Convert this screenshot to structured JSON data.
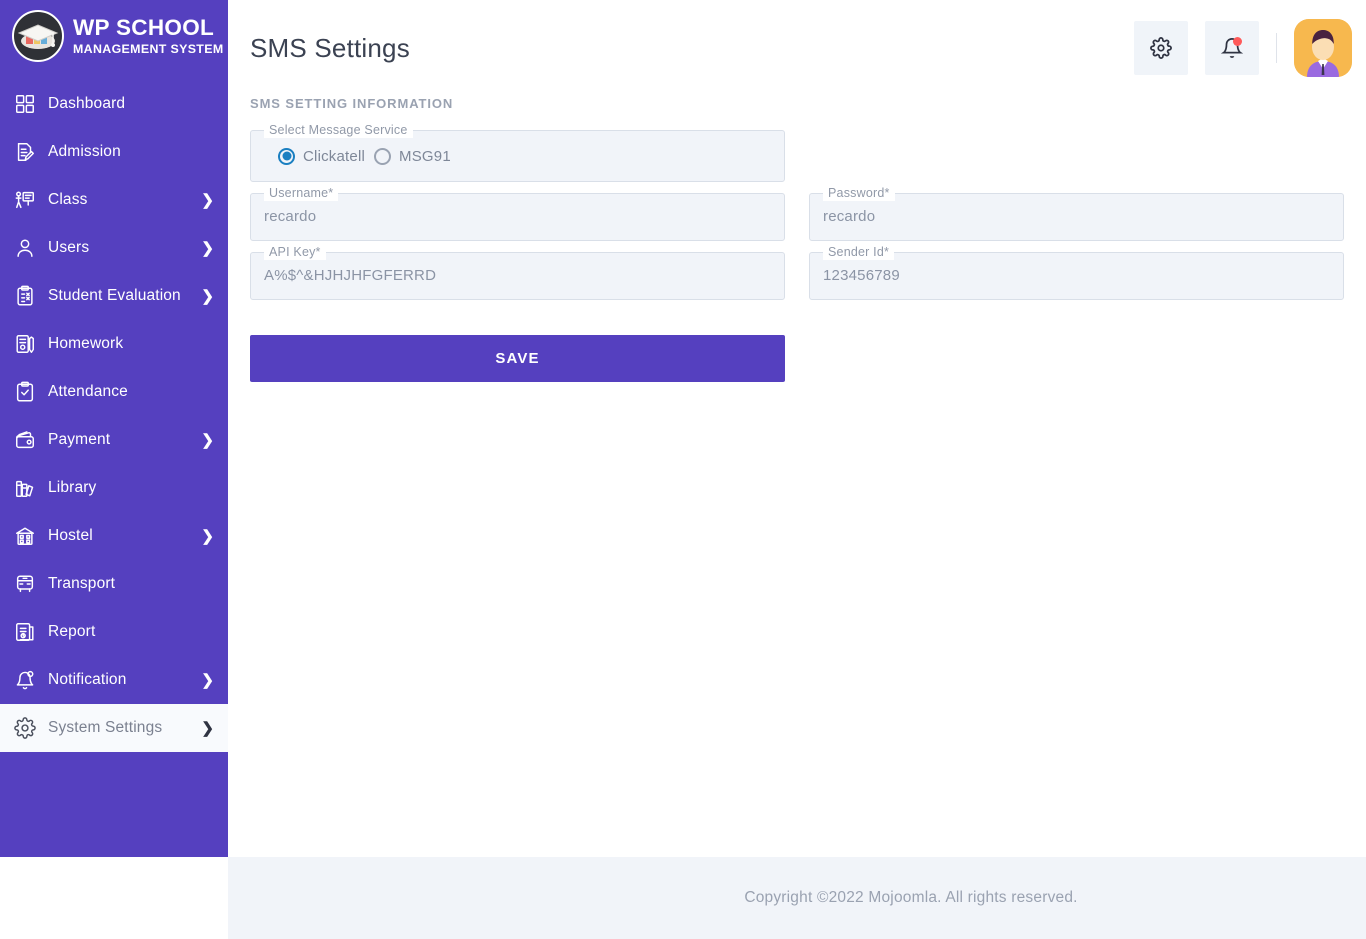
{
  "brand": {
    "logo_icon": "graduation-cap-icon",
    "name": "WP SCHOOL",
    "tagline": "MANAGEMENT SYSTEM"
  },
  "colors": {
    "sidebar_purple": "#5540bf",
    "accent_purple": "#5540bf",
    "field_bg": "#f1f4f9",
    "field_border": "#d9dfe8",
    "radio_blue": "#1a7fc1",
    "badge_red": "#ff5a5a",
    "avatar_bg": "#f7b84e",
    "footer_bg": "#f1f4f9",
    "muted_text": "#9aa2b1"
  },
  "sidebar": {
    "items": [
      {
        "label": "Dashboard",
        "icon": "grid-dashboard-icon",
        "has_arrow": false,
        "active": false
      },
      {
        "label": "Admission",
        "icon": "document-pencil-icon",
        "has_arrow": false,
        "active": false
      },
      {
        "label": "Class",
        "icon": "teacher-board-icon",
        "has_arrow": true,
        "active": false
      },
      {
        "label": "Users",
        "icon": "person-icon",
        "has_arrow": true,
        "active": false
      },
      {
        "label": "Student Evaluation",
        "icon": "clipboard-check-icon",
        "has_arrow": true,
        "active": false
      },
      {
        "label": "Homework",
        "icon": "book-pencil-icon",
        "has_arrow": false,
        "active": false
      },
      {
        "label": "Attendance",
        "icon": "clipboard-tick-icon",
        "has_arrow": false,
        "active": false
      },
      {
        "label": "Payment",
        "icon": "wallet-icon",
        "has_arrow": true,
        "active": false
      },
      {
        "label": "Library",
        "icon": "books-icon",
        "has_arrow": false,
        "active": false
      },
      {
        "label": "Hostel",
        "icon": "hostel-building-icon",
        "has_arrow": true,
        "active": false
      },
      {
        "label": "Transport",
        "icon": "bus-icon",
        "has_arrow": false,
        "active": false
      },
      {
        "label": "Report",
        "icon": "report-document-icon",
        "has_arrow": false,
        "active": false
      },
      {
        "label": "Notification",
        "icon": "bell-icon",
        "has_arrow": true,
        "active": false
      },
      {
        "label": "System Settings",
        "icon": "gear-icon",
        "has_arrow": true,
        "active": true
      }
    ],
    "arrow_glyph": "❯"
  },
  "topbar": {
    "title": "SMS Settings",
    "settings_icon": "gear-icon",
    "notifications_icon": "bell-icon",
    "has_notification_badge": true,
    "avatar_icon": "user-avatar"
  },
  "content": {
    "section_title": "SMS SETTING INFORMATION",
    "message_service": {
      "label": "Select Message Service",
      "options": [
        {
          "label": "Clickatell",
          "checked": true
        },
        {
          "label": "MSG91",
          "checked": false
        }
      ]
    },
    "fields": [
      {
        "label": "Username*",
        "value": "recardo",
        "column": "left"
      },
      {
        "label": "Password*",
        "value": "recardo",
        "column": "right"
      },
      {
        "label": "API Key*",
        "value": "A%$^&HJHJHFGFERRD",
        "column": "left"
      },
      {
        "label": "Sender Id*",
        "value": "123456789",
        "column": "right"
      }
    ],
    "save_label": "SAVE"
  },
  "footer": {
    "copyright": "Copyright ©2022 Mojoomla. All rights reserved."
  }
}
